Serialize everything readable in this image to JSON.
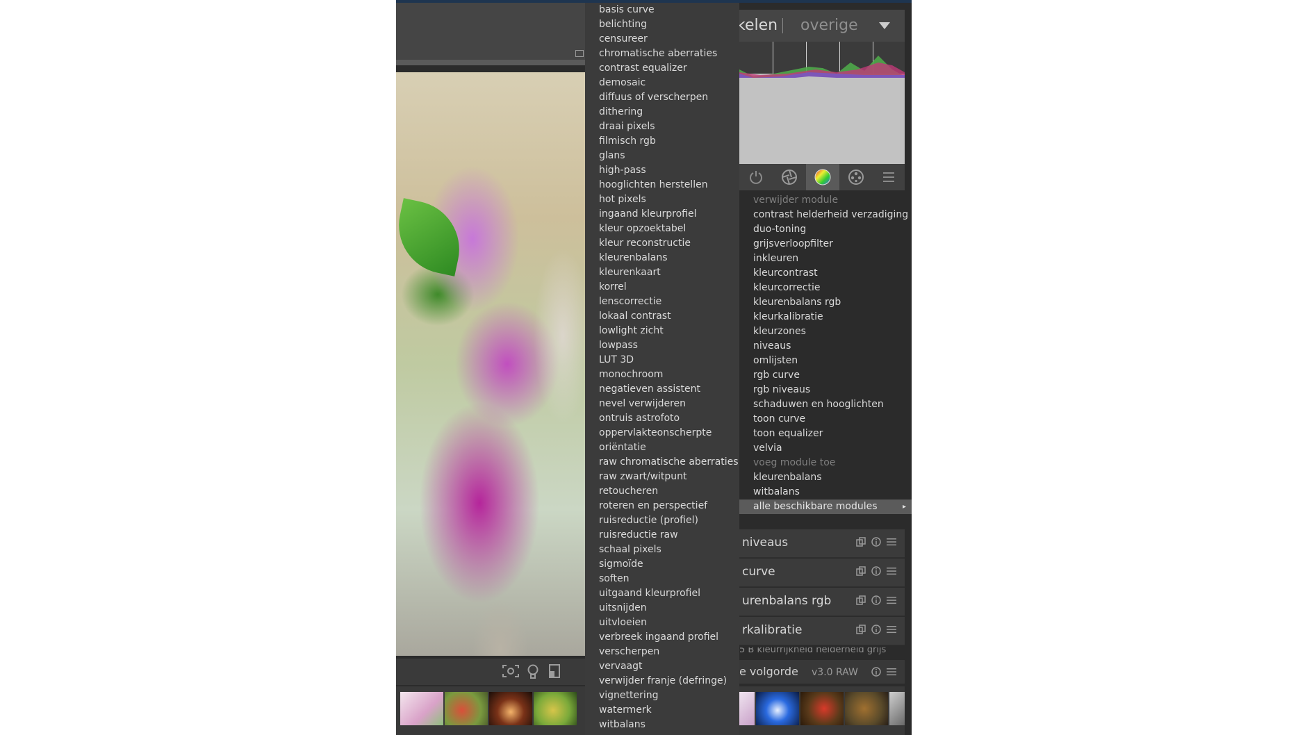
{
  "right_header": {
    "tab_partial": "kelen",
    "tab_other": "overige"
  },
  "left_menu": {
    "items": [
      "basis curve",
      "belichting",
      "censureer",
      "chromatische aberraties",
      "contrast equalizer",
      "demosaic",
      "diffuus of verscherpen",
      "dithering",
      "draai pixels",
      "filmisch rgb",
      "glans",
      "high-pass",
      "hooglichten herstellen",
      "hot pixels",
      "ingaand kleurprofiel",
      "kleur opzoektabel",
      "kleur reconstructie",
      "kleurenbalans",
      "kleurenkaart",
      "korrel",
      "lenscorrectie",
      "lokaal contrast",
      "lowlight zicht",
      "lowpass",
      "LUT 3D",
      "monochroom",
      "negatieven assistent",
      "nevel verwijderen",
      "ontruis astrofoto",
      "oppervlakteonscherpte",
      "oriëntatie",
      "raw chromatische aberraties",
      "raw zwart/witpunt",
      "retoucheren",
      "roteren en perspectief",
      "ruisreductie (profiel)",
      "ruisreductie raw",
      "schaal pixels",
      "sigmoïde",
      "soften",
      "uitgaand kleurprofiel",
      "uitsnijden",
      "uitvloeien",
      "verbreek ingaand profiel",
      "verscherpen",
      "vervaagt",
      "verwijder franje (defringe)",
      "vignettering",
      "watermerk",
      "witbalans"
    ]
  },
  "right_menu": {
    "remove_header": "verwijder module",
    "remove_items": [
      "contrast helderheid verzadiging",
      "duo-toning",
      "grijsverloopfilter",
      "inkleuren",
      "kleurcontrast",
      "kleurcorrectie",
      "kleurenbalans rgb",
      "kleurkalibratie",
      "kleurzones",
      "niveaus",
      "omlijsten",
      "rgb curve",
      "rgb niveaus",
      "schaduwen en hooglichten",
      "toon curve",
      "toon equalizer",
      "velvia"
    ],
    "add_header": "voeg module toe",
    "add_items": [
      "kleurenbalans",
      "witbalans"
    ],
    "all_modules": "alle beschikbare modules",
    "submenu_arrow": "▸"
  },
  "modules": [
    {
      "label": "niveaus"
    },
    {
      "label": "curve"
    },
    {
      "label": "urenbalans rgb"
    },
    {
      "label": "rkalibratie"
    }
  ],
  "info_line": "5 B  kleurrijkheid  helderheid  grijs",
  "history": {
    "label": "e volgorde",
    "version": "v3.0 RAW"
  },
  "colors": {
    "panel_bg": "#2b2b2b",
    "menu_bg": "#3b3b3b",
    "selected": "#5b5b5b",
    "histogram_bg": "#c2c2c2",
    "accent_top": "#1e3550"
  },
  "icons": {
    "center_toolbar": [
      "focus-peaking-icon",
      "bulb-icon",
      "display-icon"
    ],
    "module_tabs": [
      "power-icon",
      "aperture-icon",
      "color-wheel-icon",
      "film-reel-icon",
      "hamburger-icon"
    ],
    "module_row": [
      "copy-icon",
      "info-icon",
      "menu-icon"
    ]
  }
}
